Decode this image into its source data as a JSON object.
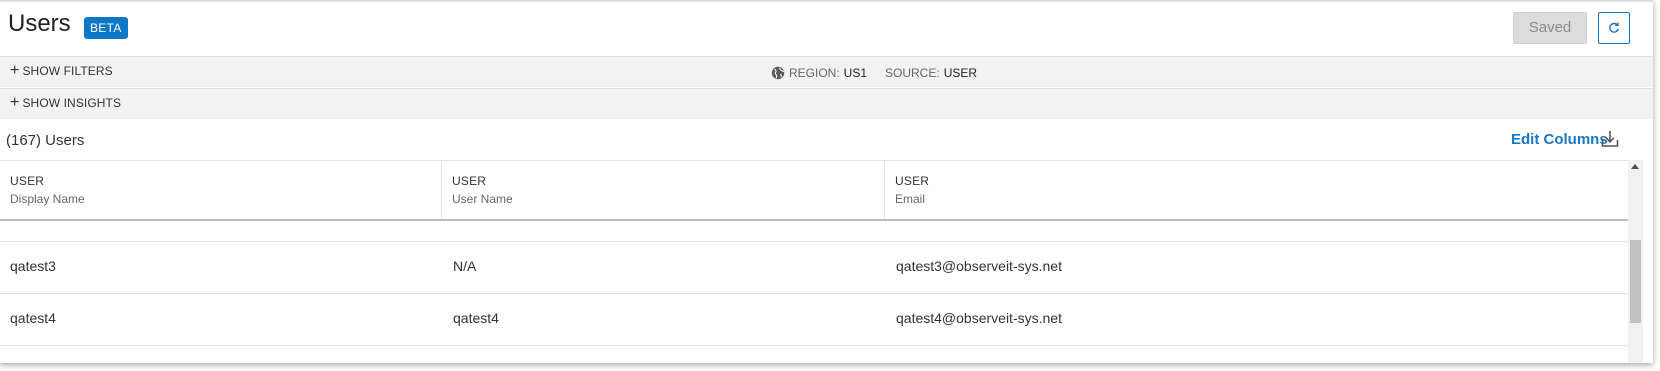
{
  "header": {
    "title": "Users",
    "badge": "BETA",
    "saved_label": "Saved"
  },
  "filters": {
    "show_filters_label": "SHOW FILTERS",
    "show_insights_label": "SHOW INSIGHTS",
    "region_key": "REGION:",
    "region_value": "US1",
    "source_key": "SOURCE:",
    "source_value": "USER"
  },
  "summary": {
    "count_label": "(167) Users",
    "edit_columns_label": "Edit Columns"
  },
  "table": {
    "columns": [
      {
        "group": "USER",
        "label": "Display Name"
      },
      {
        "group": "USER",
        "label": "User Name"
      },
      {
        "group": "USER",
        "label": "Email"
      }
    ],
    "rows": [
      {
        "display_name": "qatest3",
        "user_name": "N/A",
        "email": "qatest3@observeit-sys.net"
      },
      {
        "display_name": "qatest4",
        "user_name": "qatest4",
        "email": "qatest4@observeit-sys.net"
      }
    ]
  },
  "icons": {
    "region": "globe-icon",
    "refresh": "refresh-icon",
    "download": "download-icon",
    "expand": "plus-icon"
  },
  "colors": {
    "accent": "#1a78c2",
    "badge": "#0a78c5",
    "bar_bg": "#f2f2f2",
    "saved_bg": "#dcdcdc"
  }
}
